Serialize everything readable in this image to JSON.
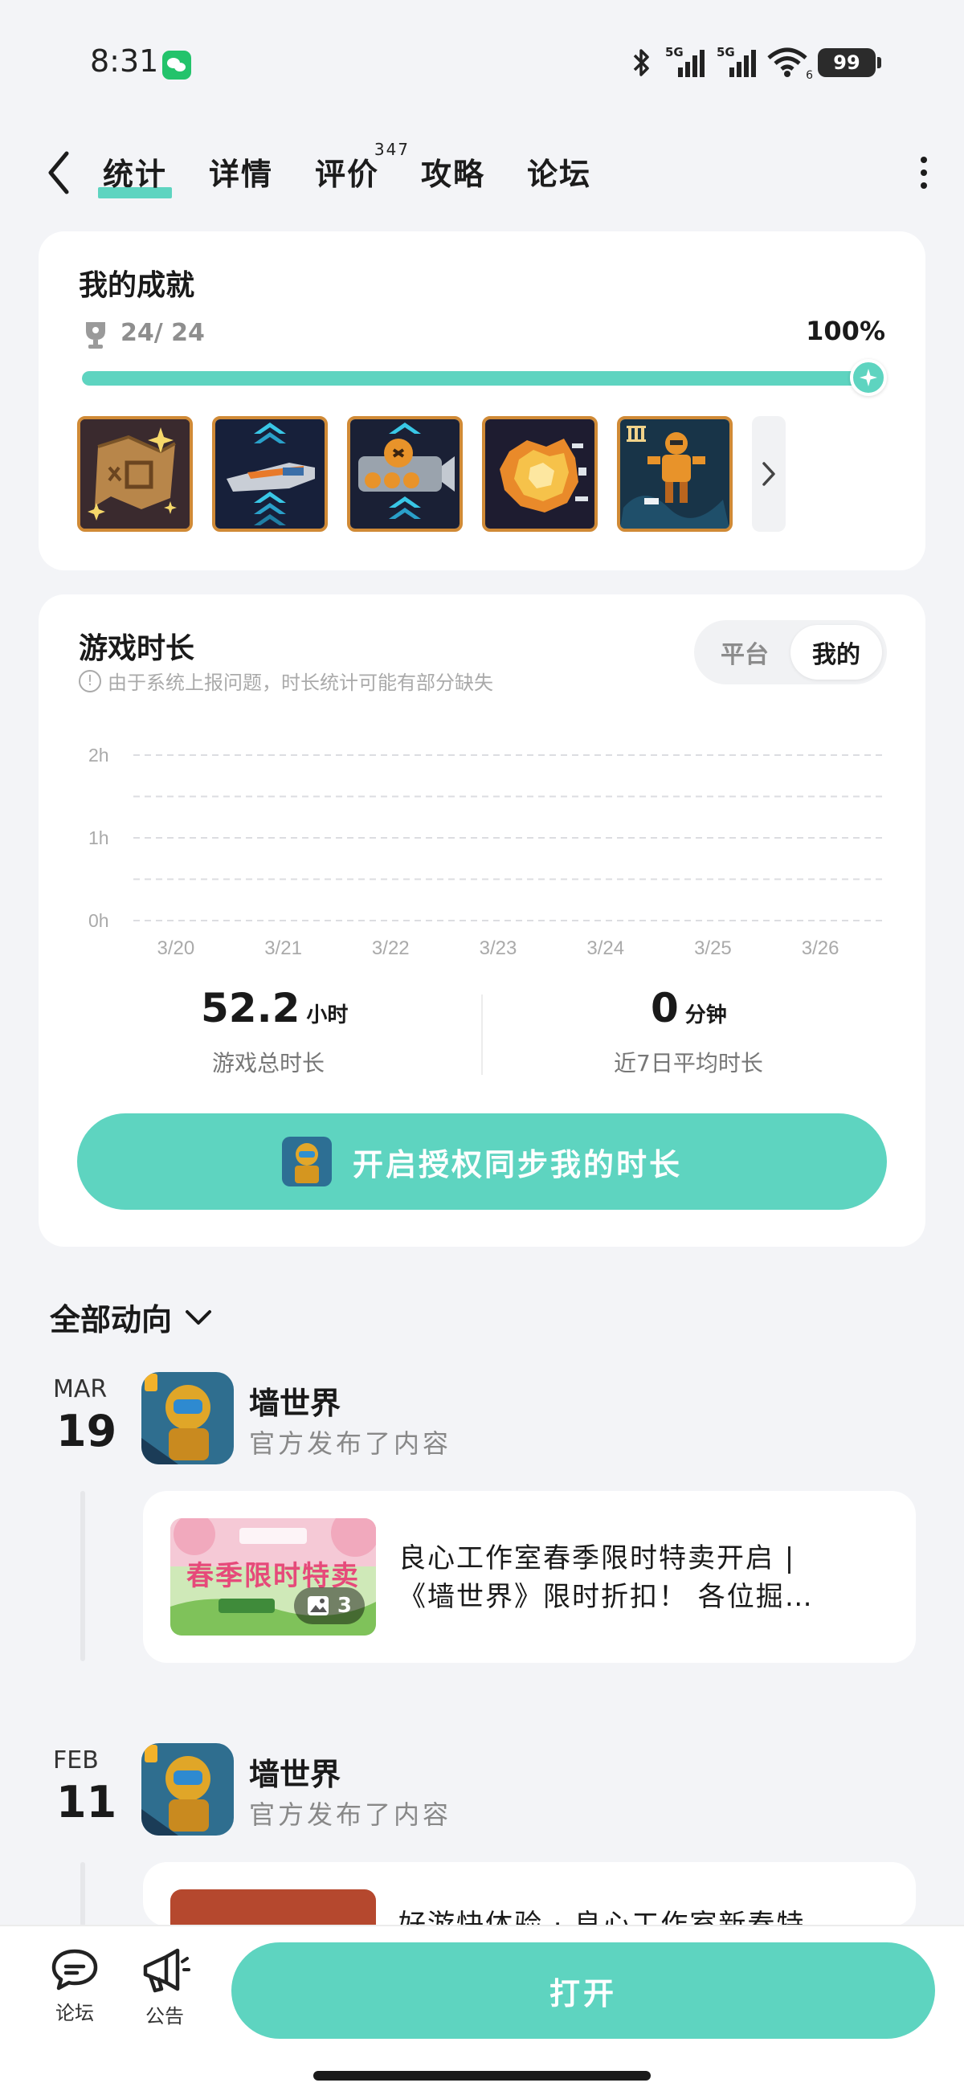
{
  "status_bar": {
    "time": "8:31",
    "signal1": "5G",
    "signal2": "5G",
    "wifi_sub": "6",
    "battery": "99"
  },
  "nav": {
    "tabs": [
      {
        "label": "统计",
        "active": true
      },
      {
        "label": "详情"
      },
      {
        "label": "评价",
        "badge": "347"
      },
      {
        "label": "攻略"
      },
      {
        "label": "论坛"
      }
    ]
  },
  "achievements": {
    "title": "我的成就",
    "count": "24/ 24",
    "percent_text": "100%",
    "progress": 1.0
  },
  "play_time": {
    "title": "游戏时长",
    "note": "由于系统上报问题，时长统计可能有部分缺失",
    "toggle": [
      "平台",
      "我的"
    ],
    "toggle_selected": "我的",
    "total_value": "52.2",
    "total_unit": "小时",
    "total_label": "游戏总时长",
    "avg_value": "0",
    "avg_unit": "分钟",
    "avg_label": "近7日平均时长",
    "sync_button": "开启授权同步我的时长"
  },
  "chart_data": {
    "type": "bar",
    "categories": [
      "3/20",
      "3/21",
      "3/22",
      "3/23",
      "3/24",
      "3/25",
      "3/26"
    ],
    "values": [
      0,
      0,
      0,
      0,
      0,
      0,
      0
    ],
    "y_ticks": [
      "2h",
      "1h",
      "0h"
    ],
    "ylim": [
      0,
      2
    ],
    "grid": true
  },
  "feed": {
    "filter_label": "全部动向",
    "posts": [
      {
        "month": "MAR",
        "day": "19",
        "game": "墙世界",
        "action": "官方发布了内容",
        "line1": "良心工作室春季限时特卖开启 |",
        "line2": "《墙世界》限时折扣！ 各位掘…",
        "image_count": "3",
        "thumb_text": "春季限时特卖"
      },
      {
        "month": "FEB",
        "day": "11",
        "game": "墙世界",
        "action": "官方发布了内容",
        "line1": "好游快体验 · 良心工作室新春特"
      }
    ]
  },
  "bottom_bar": {
    "forum_label": "论坛",
    "notice_label": "公告",
    "open_button": "打开"
  },
  "colors": {
    "accent": "#5ed4c0",
    "background": "#f3f4f7"
  }
}
